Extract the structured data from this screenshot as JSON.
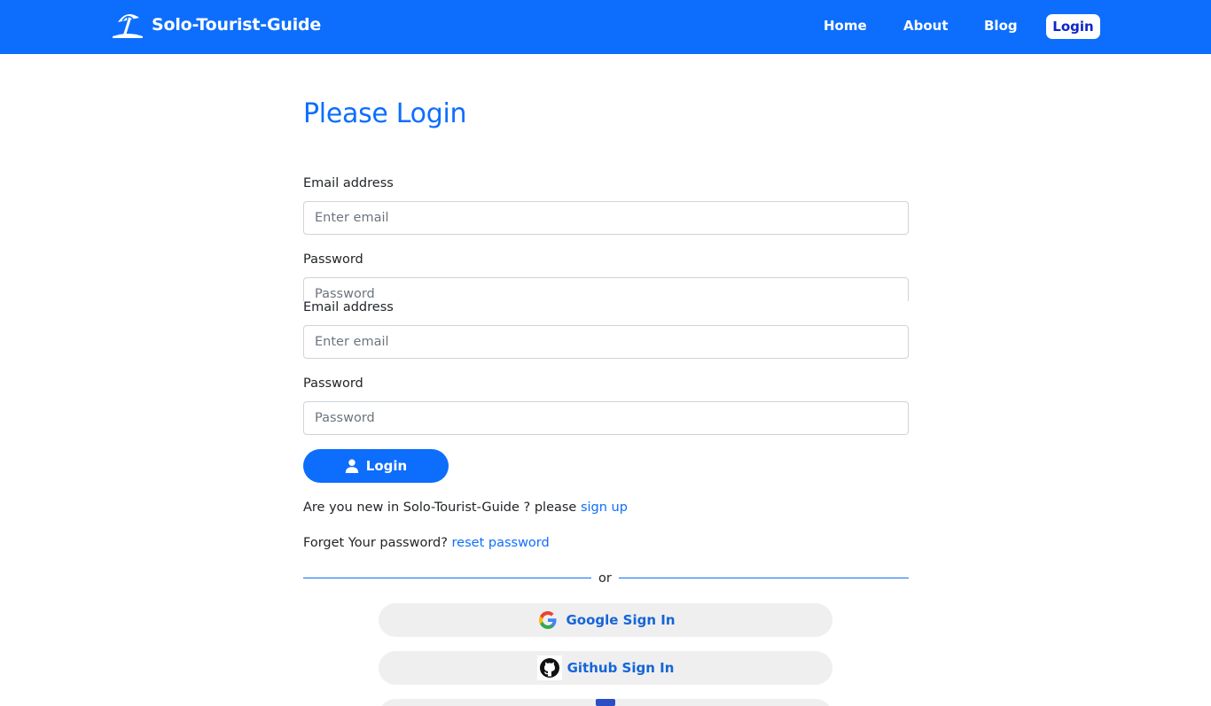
{
  "nav": {
    "brand": "Solo-Tourist-Guide",
    "links": {
      "home": "Home",
      "about": "About",
      "blog": "Blog",
      "login": "Login"
    }
  },
  "page": {
    "title": "Please Login"
  },
  "form_ghost": {
    "email_label": "Email address",
    "email_placeholder": "Enter email",
    "password_label": "Password",
    "password_placeholder": "Password"
  },
  "form": {
    "email_label": "Email address",
    "email_placeholder": "Enter email",
    "password_label": "Password",
    "password_placeholder": "Password",
    "submit_label": "Login"
  },
  "signup": {
    "prefix": "Are you new in Solo-Tourist-Guide ? please ",
    "link": "sign up"
  },
  "reset": {
    "prefix": "Forget Your password? ",
    "link": "reset password"
  },
  "divider": {
    "text": "or"
  },
  "social": {
    "google": "Google Sign In",
    "github": "Github Sign In"
  },
  "colors": {
    "primary": "#0d6efd",
    "social_bg": "#efefef",
    "social_text": "#1565d8"
  },
  "icons": {
    "brand": "beach-umbrella-icon",
    "submit": "user-icon",
    "google": "google-icon",
    "github": "github-icon"
  }
}
